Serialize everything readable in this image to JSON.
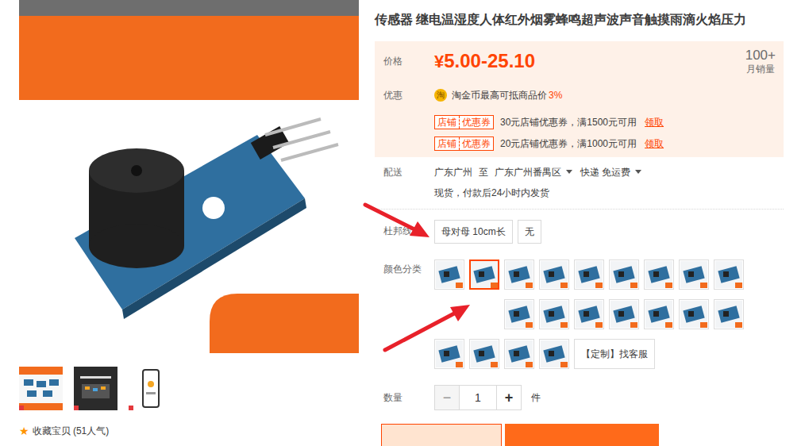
{
  "title": "传感器 继电温湿度人体红外烟雾蜂鸣超声波声音触摸雨滴火焰压力",
  "thumbnails": [
    {
      "kind": "kit"
    },
    {
      "kind": "qr"
    },
    {
      "kind": "phone"
    }
  ],
  "favorite": {
    "icon": "★",
    "label": "收藏宝贝 (51人气)"
  },
  "price": {
    "label": "价格",
    "currency": "¥",
    "value": "5.00-25.10"
  },
  "sales": {
    "count": "100+",
    "label": "月销量"
  },
  "promo": {
    "label": "优惠",
    "coin_icon": "淘",
    "coin_text": "淘金币最高可抵商品价",
    "coin_rate": "3%",
    "coupons": [
      {
        "tag_left": "店铺",
        "tag_right": "优惠券",
        "text": "30元店铺优惠券，满1500元可用",
        "action": "领取"
      },
      {
        "tag_left": "店铺",
        "tag_right": "优惠券",
        "text": "20元店铺优惠券，满1000元可用",
        "action": "领取"
      }
    ]
  },
  "delivery": {
    "label": "配送",
    "from": "广东广州",
    "to_word": "至",
    "to": "广东广州番禺区",
    "method": "快递 免运费",
    "stock": "现货，付款后24小时内发货"
  },
  "dupont": {
    "label": "杜邦线",
    "options": [
      {
        "text": "母对母 10cm长",
        "selected": false
      },
      {
        "text": "无",
        "selected": false
      }
    ]
  },
  "colors": {
    "label": "颜色分类",
    "options": [
      {
        "selected": false
      },
      {
        "selected": true
      },
      {
        "selected": false
      },
      {
        "selected": false
      },
      {
        "selected": false
      },
      {
        "selected": false
      },
      {
        "selected": false
      },
      {
        "selected": false
      },
      {
        "selected": false
      },
      {
        "selected": false
      },
      {
        "selected": false
      },
      {
        "selected": false
      },
      {
        "selected": false
      },
      {
        "selected": false
      },
      {
        "selected": false
      },
      {
        "selected": false
      },
      {
        "selected": false
      },
      {
        "selected": false
      },
      {
        "selected": false
      },
      {
        "selected": false
      }
    ],
    "custom_button": "【定制】找客服"
  },
  "quantity": {
    "label": "数量",
    "minus": "−",
    "value": "1",
    "plus": "+",
    "unit": "件"
  }
}
